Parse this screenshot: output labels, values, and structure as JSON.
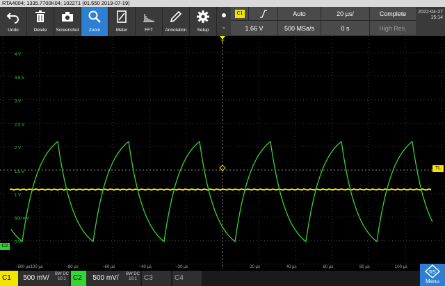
{
  "titlebar": "RTA4004; 1335.7700K04; 102271 (01.550 2019-07-19)",
  "toolbar": [
    {
      "id": "undo",
      "label": "Undo",
      "icon": "undo-icon",
      "active": false
    },
    {
      "id": "delete",
      "label": "Delete",
      "icon": "trash-icon",
      "active": false
    },
    {
      "id": "screenshot",
      "label": "Screenshot",
      "icon": "camera-icon",
      "active": false
    },
    {
      "id": "zoom",
      "label": "Zoom",
      "icon": "zoom-icon",
      "active": true
    },
    {
      "id": "meter",
      "label": "Meter",
      "icon": "meter-icon",
      "active": false
    },
    {
      "id": "fft",
      "label": "FFT",
      "icon": "fft-icon",
      "active": false
    },
    {
      "id": "annotation",
      "label": "Annotation",
      "icon": "pencil-icon",
      "active": false
    },
    {
      "id": "setup",
      "label": "Setup",
      "icon": "gear-icon",
      "active": false
    }
  ],
  "trigger": {
    "channel": "C1",
    "slope_icon": "rising-edge-icon",
    "mode": "Auto",
    "level": "1.66 V"
  },
  "horizontal": {
    "time_scale": "20 µs/",
    "sample_rate": "500 MSa/s",
    "position": "0 s"
  },
  "acquisition": {
    "state": "Complete",
    "mode": "High Res."
  },
  "datetime": {
    "date": "2022-04-27",
    "time": "15:14"
  },
  "grid": {
    "y_labels": [
      "4 V",
      "3.5 V",
      "3 V",
      "2.5 V",
      "2 V",
      "1.5 V",
      "1 V",
      "500 mV",
      "0 V"
    ],
    "x_labels": [
      "−100 µs",
      "−80 µs",
      "−60 µs",
      "−40 µs",
      "−20 µs",
      "20 µs",
      "40 µs",
      "60 µs",
      "80 µs",
      "100 µs"
    ],
    "x_left_edge_label": "−500 µs"
  },
  "markers": {
    "c2": "C2",
    "trigger_level": "TL",
    "trigger_pos": "T"
  },
  "colors": {
    "c1": "#f2e600",
    "c2": "#33d633",
    "active": "#2d7fd3"
  },
  "channels": [
    {
      "id": "C1",
      "scale": "500 mV/",
      "coupling_top": "BW DC",
      "coupling_bottom": "10:1",
      "color": "#f2e600",
      "active": true
    },
    {
      "id": "C2",
      "scale": "500 mV/",
      "coupling_top": "BW DC",
      "coupling_bottom": "10:1",
      "color": "#33d633",
      "active": true
    },
    {
      "id": "C3",
      "active": false
    },
    {
      "id": "C4",
      "active": false
    }
  ],
  "menu_label": "Menu"
}
